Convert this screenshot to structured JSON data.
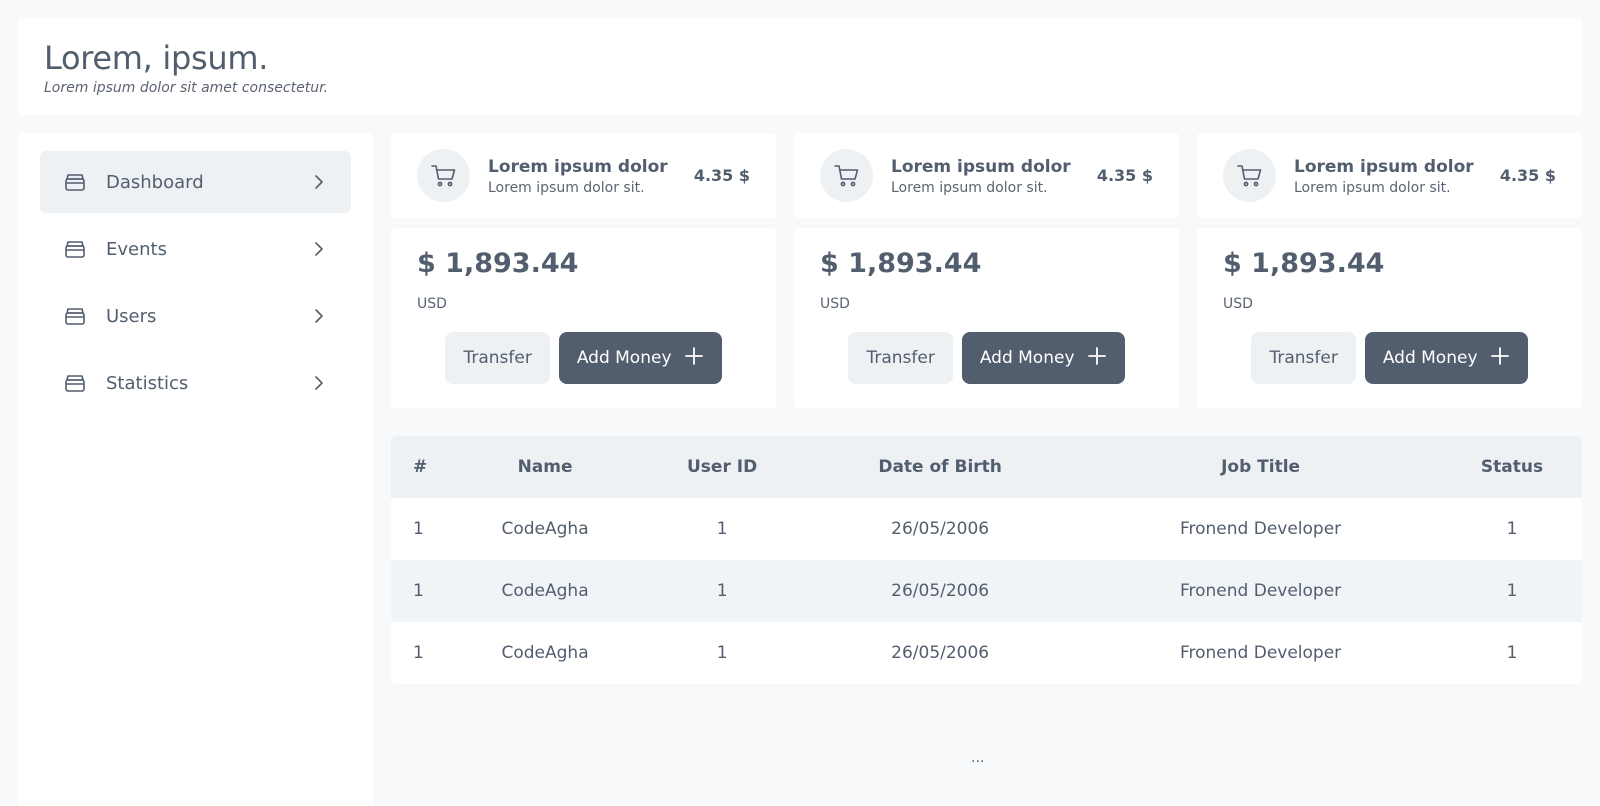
{
  "header": {
    "title": "Lorem, ipsum.",
    "subtitle": "Lorem ipsum dolor sit amet consectetur."
  },
  "sidebar": {
    "items": [
      {
        "label": "Dashboard",
        "icon": "archive-icon",
        "active": true
      },
      {
        "label": "Events",
        "icon": "archive-icon",
        "active": false
      },
      {
        "label": "Users",
        "icon": "archive-icon",
        "active": false
      },
      {
        "label": "Statistics",
        "icon": "archive-icon",
        "active": false
      }
    ]
  },
  "cards": [
    {
      "title": "Lorem ipsum dolor",
      "subtitle": "Lorem ipsum dolor sit.",
      "price": "4.35 $",
      "balance": "$ 1,893.44",
      "currency": "USD",
      "transfer_label": "Transfer",
      "add_label": "Add Money"
    },
    {
      "title": "Lorem ipsum dolor",
      "subtitle": "Lorem ipsum dolor sit.",
      "price": "4.35 $",
      "balance": "$ 1,893.44",
      "currency": "USD",
      "transfer_label": "Transfer",
      "add_label": "Add Money"
    },
    {
      "title": "Lorem ipsum dolor",
      "subtitle": "Lorem ipsum dolor sit.",
      "price": "4.35 $",
      "balance": "$ 1,893.44",
      "currency": "USD",
      "transfer_label": "Transfer",
      "add_label": "Add Money"
    }
  ],
  "table": {
    "columns": [
      "#",
      "Name",
      "User ID",
      "Date of Birth",
      "Job Title",
      "Status"
    ],
    "rows": [
      [
        "1",
        "CodeAgha",
        "1",
        "26/05/2006",
        "Fronend Developer",
        "1"
      ],
      [
        "1",
        "CodeAgha",
        "1",
        "26/05/2006",
        "Fronend Developer",
        "1"
      ],
      [
        "1",
        "CodeAgha",
        "1",
        "26/05/2006",
        "Fronend Developer",
        "1"
      ]
    ]
  },
  "footer": {
    "ellipsis": "..."
  },
  "colors": {
    "primary": "#525e6e",
    "surface": "#ffffff",
    "muted_bg": "#eef1f4",
    "page_bg": "#f8f9fb"
  }
}
